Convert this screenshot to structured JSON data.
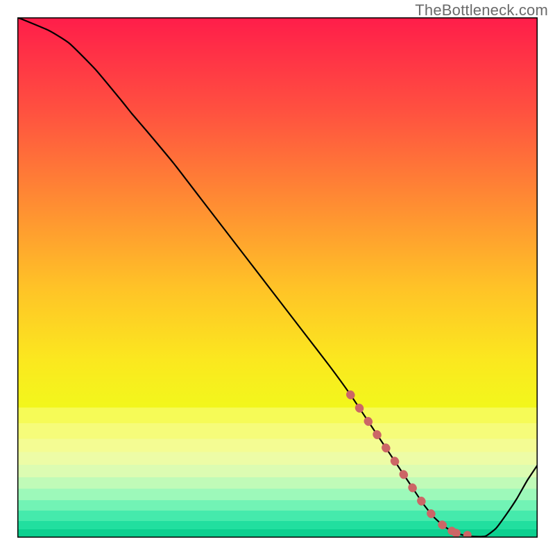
{
  "watermark": "TheBottleneck.com",
  "chart_data": {
    "type": "line",
    "title": "",
    "xlabel": "",
    "ylabel": "",
    "xlim": [
      0,
      100
    ],
    "ylim": [
      0,
      100
    ],
    "series": [
      {
        "name": "curve",
        "x": [
          0,
          6,
          10,
          15,
          20,
          22,
          25,
          30,
          35,
          40,
          45,
          50,
          55,
          60,
          64,
          68,
          72,
          76,
          78,
          80,
          82,
          84,
          86,
          88,
          90,
          92,
          94,
          96,
          98,
          100
        ],
        "y": [
          100,
          97.5,
          95,
          90,
          84,
          81.5,
          78,
          72,
          65.5,
          59,
          52.5,
          46,
          39.5,
          33,
          27.5,
          21.5,
          15.5,
          9.5,
          6.5,
          4,
          2.2,
          1.0,
          0.4,
          0.2,
          0.3,
          1.8,
          4.5,
          7.5,
          11,
          14
        ]
      },
      {
        "name": "highlight",
        "x": [
          64,
          66,
          68,
          70,
          72,
          74,
          76,
          78,
          80,
          81,
          82,
          83,
          84,
          85,
          87
        ],
        "y": [
          27.5,
          24.5,
          21.5,
          18.5,
          15.5,
          12.5,
          9.5,
          6.5,
          4.0,
          3.0,
          2.2,
          1.6,
          1.0,
          0.7,
          0.4
        ]
      }
    ],
    "gradient_stops": [
      {
        "offset": 0.0,
        "color": "#ff1d4a"
      },
      {
        "offset": 0.18,
        "color": "#ff5140"
      },
      {
        "offset": 0.35,
        "color": "#ff8a33"
      },
      {
        "offset": 0.52,
        "color": "#ffc327"
      },
      {
        "offset": 0.66,
        "color": "#fbe81f"
      },
      {
        "offset": 0.75,
        "color": "#f2f71c"
      }
    ],
    "bands": [
      {
        "y0": 0.75,
        "y1": 0.78,
        "color": "#f6fb57"
      },
      {
        "y0": 0.78,
        "y1": 0.81,
        "color": "#f6fc7a"
      },
      {
        "y0": 0.81,
        "y1": 0.835,
        "color": "#f4fc93"
      },
      {
        "y0": 0.835,
        "y1": 0.86,
        "color": "#edfca6"
      },
      {
        "y0": 0.86,
        "y1": 0.884,
        "color": "#dcfcb2"
      },
      {
        "y0": 0.884,
        "y1": 0.906,
        "color": "#c0fbb8"
      },
      {
        "y0": 0.906,
        "y1": 0.928,
        "color": "#9df9ba"
      },
      {
        "y0": 0.928,
        "y1": 0.948,
        "color": "#72f3b5"
      },
      {
        "y0": 0.948,
        "y1": 0.968,
        "color": "#45eaac"
      },
      {
        "y0": 0.968,
        "y1": 0.984,
        "color": "#21df9f"
      },
      {
        "y0": 0.984,
        "y1": 1.0,
        "color": "#0cd08f"
      }
    ],
    "colors": {
      "curve": "#000000",
      "highlight": "#cc6666",
      "border": "#000000"
    }
  }
}
